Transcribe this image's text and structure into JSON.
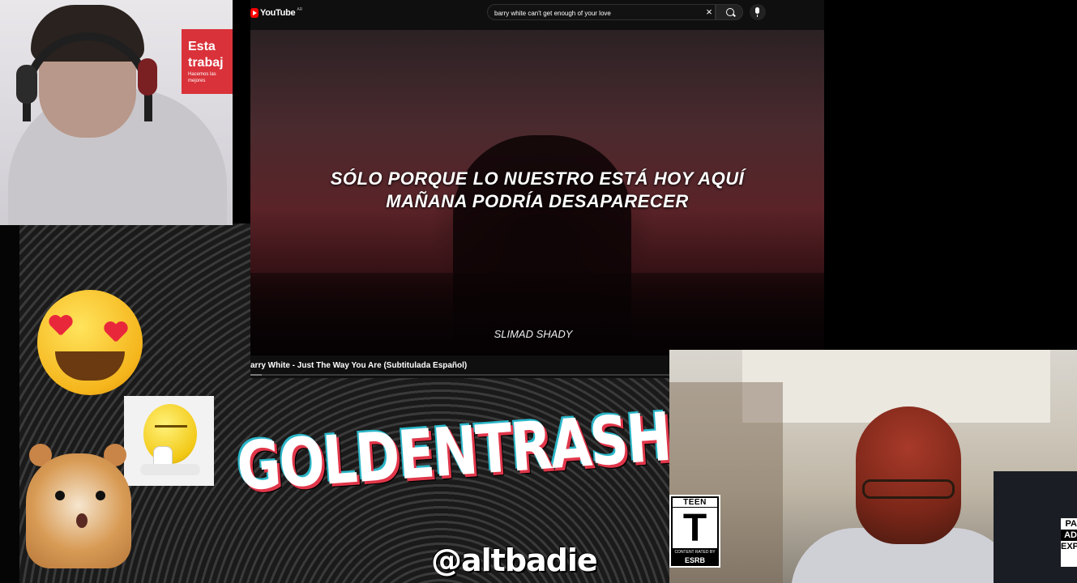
{
  "webcam": {
    "sign_text_1": "Esta",
    "sign_text_2": "trabaj",
    "sign_small": "Hacemos las mejores"
  },
  "youtube": {
    "logo_text": "YouTube",
    "region": "AR",
    "search": {
      "value": "barry white can't get enough of your love",
      "clear_icon": "×"
    },
    "video": {
      "lyric_line_1": "SÓLO PORQUE LO NUESTRO ESTÁ HOY AQUÍ",
      "lyric_line_2": "MAÑANA PODRÍA DESAPARECER",
      "credit": "SLIMAD SHADY",
      "title": "arry White - Just The Way You Are (Subtitulada Español)",
      "progress": 0.02
    }
  },
  "overlay": {
    "brand": "GOLDENTRASH",
    "handle": "@altbadie"
  },
  "esrb": {
    "rating_word": "TEEN",
    "letter": "T",
    "small_text": "CONTENT RATED BY",
    "org": "ESRB"
  },
  "parental_advisory": {
    "line1": "PA",
    "line2": "AD",
    "line3": "EXP"
  },
  "colors": {
    "youtube_red": "#ff0000",
    "sign_red": "#d9323a",
    "brand_shadow_red": "#e0364a",
    "brand_shadow_cyan": "#2ab6c8"
  }
}
